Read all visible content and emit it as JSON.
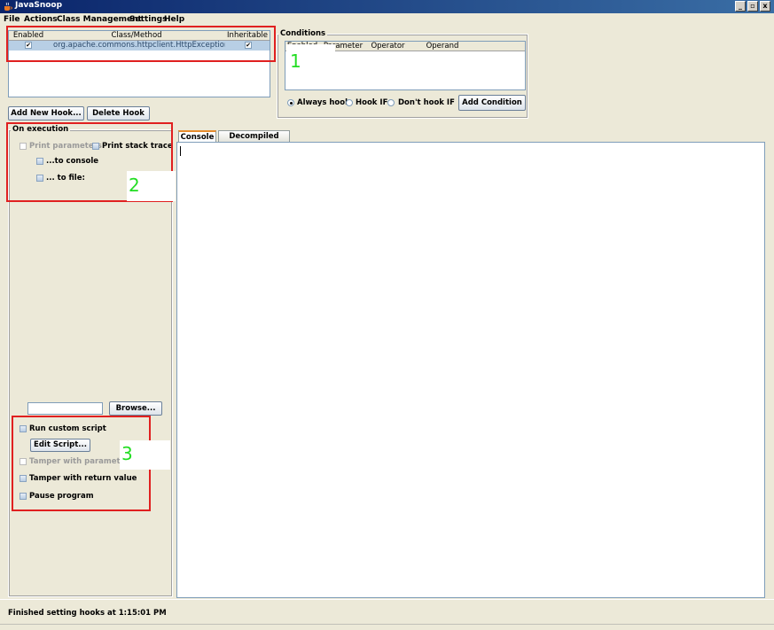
{
  "window": {
    "title": "JavaSnoop",
    "controls": [
      "_",
      "▫",
      "x"
    ]
  },
  "menu": [
    "File",
    "Actions",
    "Class Management",
    "Settings",
    "Help"
  ],
  "hooks_table": {
    "columns": [
      "Enabled",
      "Class/Method",
      "Inheritable"
    ],
    "rows": [
      {
        "enabled": "✔",
        "method": "org.apache.commons.httpclient.HttpException.get...",
        "inheritable": "✔"
      }
    ]
  },
  "hook_buttons": {
    "add": "Add New Hook...",
    "delete": "Delete Hook"
  },
  "conditions": {
    "title": "Conditions",
    "columns": [
      "Enabled",
      "Parameter",
      "Operator",
      "Operand"
    ],
    "radios": [
      "Always hook",
      "Hook IF",
      "Don't hook IF"
    ],
    "selected": "Always hook",
    "add_button": "Add Condition"
  },
  "on_execution": {
    "title": "On execution",
    "print_parameters": "Print parameters",
    "print_stack_trace": "Print stack trace",
    "to_console": "...to console",
    "to_file": "... to file:"
  },
  "browse_button": "Browse...",
  "script_options": {
    "run_custom_script": "Run custom script",
    "edit_script": "Edit Script...",
    "tamper_parameters": "Tamper with parameters",
    "tamper_return": "Tamper with return value",
    "pause_program": "Pause program"
  },
  "tabs": [
    "Console",
    "Decompiled Code"
  ],
  "active_tab": "Console",
  "status": "Finished setting hooks at 1:15:01 PM",
  "annotations": [
    "1",
    "2",
    "3"
  ],
  "colors": {
    "highlight_red": "#e02020",
    "annotation_green": "#22dd22",
    "selection": "#b8cfe5"
  }
}
